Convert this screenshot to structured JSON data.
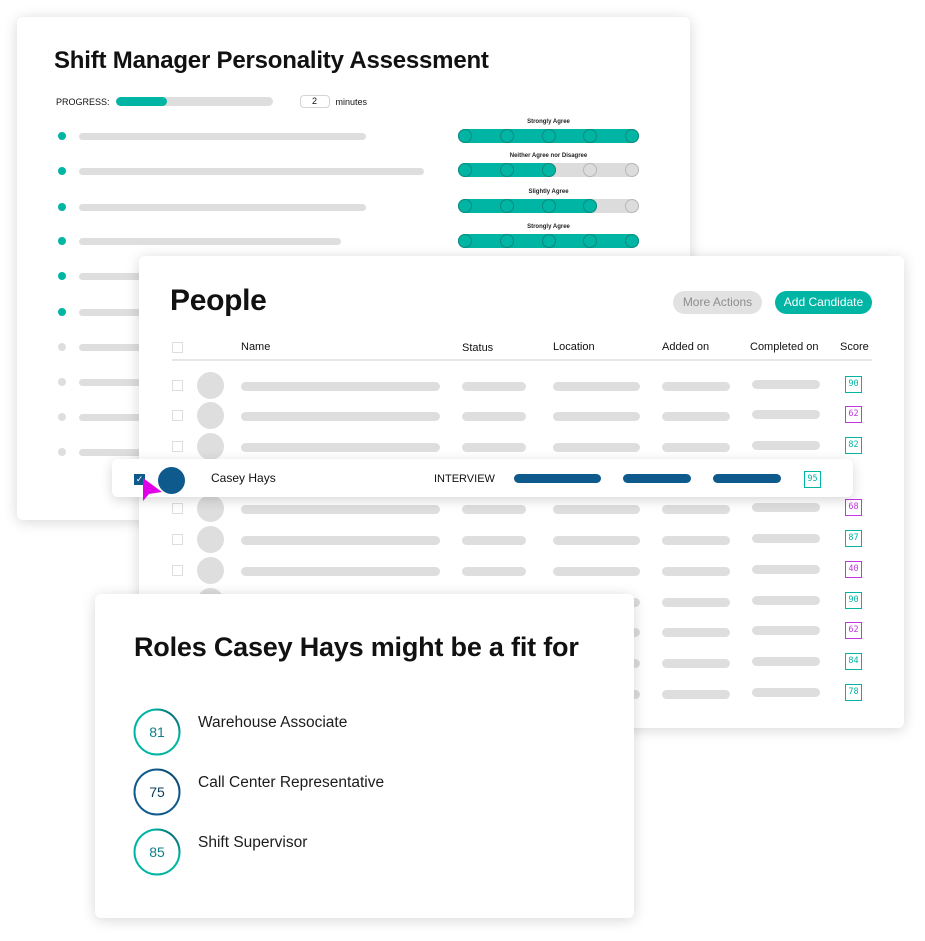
{
  "colors": {
    "teal": "#00b5a3",
    "navy": "#0f5a8c",
    "purple": "#c535e6",
    "placeholder": "#dedede",
    "cursor": "#e000e8"
  },
  "assessment": {
    "title": "Shift Manager Personality Assessment",
    "progress_label": "PROGRESS:",
    "progress_fraction": 0.33,
    "minutes_value": "2",
    "minutes_label": "minutes",
    "questions": [
      {
        "answered": true
      },
      {
        "answered": true
      },
      {
        "answered": true
      },
      {
        "answered": true
      },
      {
        "answered": true
      },
      {
        "answered": true
      },
      {
        "answered": false
      },
      {
        "answered": false
      },
      {
        "answered": false
      },
      {
        "answered": false
      }
    ],
    "responses": [
      {
        "label": "Strongly Agree",
        "value": 5,
        "of": 5
      },
      {
        "label": "Neither Agree nor Disagree",
        "value": 3,
        "of": 5
      },
      {
        "label": "Slightly Agree",
        "value": 4,
        "of": 5
      },
      {
        "label": "Strongly Agree",
        "value": 5,
        "of": 5
      }
    ]
  },
  "people": {
    "title": "People",
    "more_actions_label": "More Actions",
    "add_candidate_label": "Add Candidate",
    "columns": [
      "Name",
      "Status",
      "Location",
      "Added on",
      "Completed on",
      "Score"
    ],
    "scores": [
      {
        "value": "90",
        "tone": "teal"
      },
      {
        "value": "62",
        "tone": "purple"
      },
      {
        "value": "82",
        "tone": "teal"
      },
      {
        "value": "95",
        "tone": "teal",
        "highlighted": true
      },
      {
        "value": "68",
        "tone": "purple"
      },
      {
        "value": "87",
        "tone": "teal"
      },
      {
        "value": "40",
        "tone": "purple"
      },
      {
        "value": "90",
        "tone": "teal"
      },
      {
        "value": "62",
        "tone": "purple"
      },
      {
        "value": "84",
        "tone": "teal"
      },
      {
        "value": "78",
        "tone": "teal"
      }
    ],
    "selected_row": {
      "name": "Casey Hays",
      "status": "INTERVIEW",
      "score": "95",
      "checked": true
    }
  },
  "roles": {
    "title": "Roles Casey Hays might be a fit for",
    "items": [
      {
        "score": "81",
        "name": "Warehouse Associate",
        "tone": "teal"
      },
      {
        "score": "75",
        "name": "Call Center Representative",
        "tone": "navy"
      },
      {
        "score": "85",
        "name": "Shift Supervisor",
        "tone": "teal"
      }
    ]
  }
}
